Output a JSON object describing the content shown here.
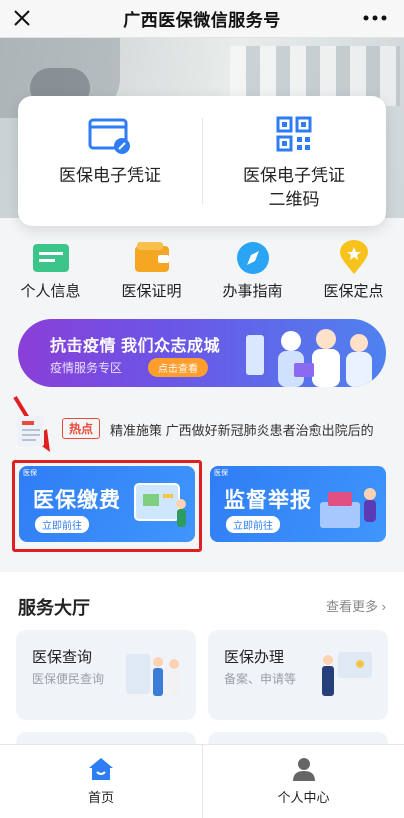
{
  "topbar": {
    "title": "广西医保微信服务号",
    "close_icon": "close-icon",
    "more_icon": "more-dots-icon"
  },
  "credentials": {
    "left": {
      "label": "医保电子凭证",
      "icon": "id-card-icon"
    },
    "right": {
      "label_line1": "医保电子凭证",
      "label_line2": "二维码",
      "icon": "qr-code-icon"
    }
  },
  "quick_links": [
    {
      "label": "个人信息",
      "icon": "person-card-icon",
      "color": "#3bc58a"
    },
    {
      "label": "医保证明",
      "icon": "wallet-icon",
      "color": "#f5a623"
    },
    {
      "label": "办事指南",
      "icon": "compass-icon",
      "color": "#2aa4f4"
    },
    {
      "label": "医保定点",
      "icon": "location-pin-icon",
      "color": "#f7c21b"
    }
  ],
  "banner": {
    "title": "抗击疫情 我们众志成城",
    "subtitle": "疫情服务专区",
    "button": "点击查看"
  },
  "hot_news": {
    "badge": "热点",
    "text": "精准施策 广西做好新冠肺炎患者治愈出院后的"
  },
  "promos": [
    {
      "tag": "医保",
      "title": "医保缴费",
      "button": "立即前往"
    },
    {
      "tag": "医保",
      "title": "监督举报",
      "button": "立即前往"
    }
  ],
  "service_hall": {
    "title": "服务大厅",
    "more": "查看更多",
    "cards": [
      {
        "title": "医保查询",
        "subtitle": "医保便民查询"
      },
      {
        "title": "医保办理",
        "subtitle": "备案、申请等"
      }
    ]
  },
  "tabbar": {
    "home": {
      "label": "首页",
      "icon": "home-icon",
      "color": "#2f7df5"
    },
    "profile": {
      "label": "个人中心",
      "icon": "user-icon",
      "color": "#666666"
    }
  }
}
